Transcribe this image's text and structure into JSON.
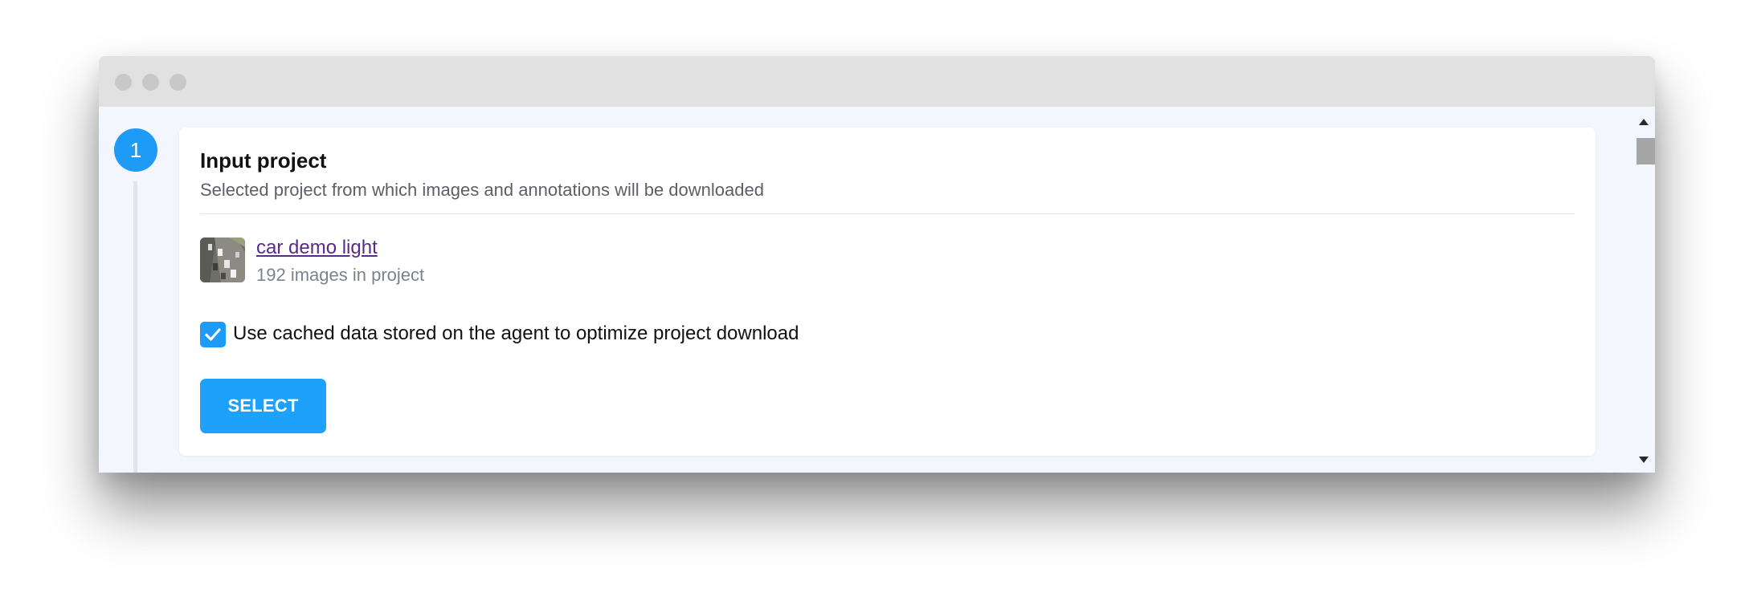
{
  "window": {
    "controls": [
      "close-dot",
      "minimize-dot",
      "maximize-dot"
    ]
  },
  "step": {
    "number": "1"
  },
  "card": {
    "title": "Input project",
    "description": "Selected project from which images and annotations will be downloaded"
  },
  "project": {
    "name": "car demo light",
    "meta": "192 images in project",
    "thumbnail_icon": "project-thumbnail"
  },
  "options": {
    "use_cache_label": "Use cached data stored on the agent to optimize project download",
    "use_cache_checked": true
  },
  "actions": {
    "select_label": "SELECT"
  },
  "colors": {
    "accent": "#1e9bf7",
    "link": "#5b2a86",
    "background": "#f4f6fd",
    "titlebar": "#e1e1e1"
  }
}
